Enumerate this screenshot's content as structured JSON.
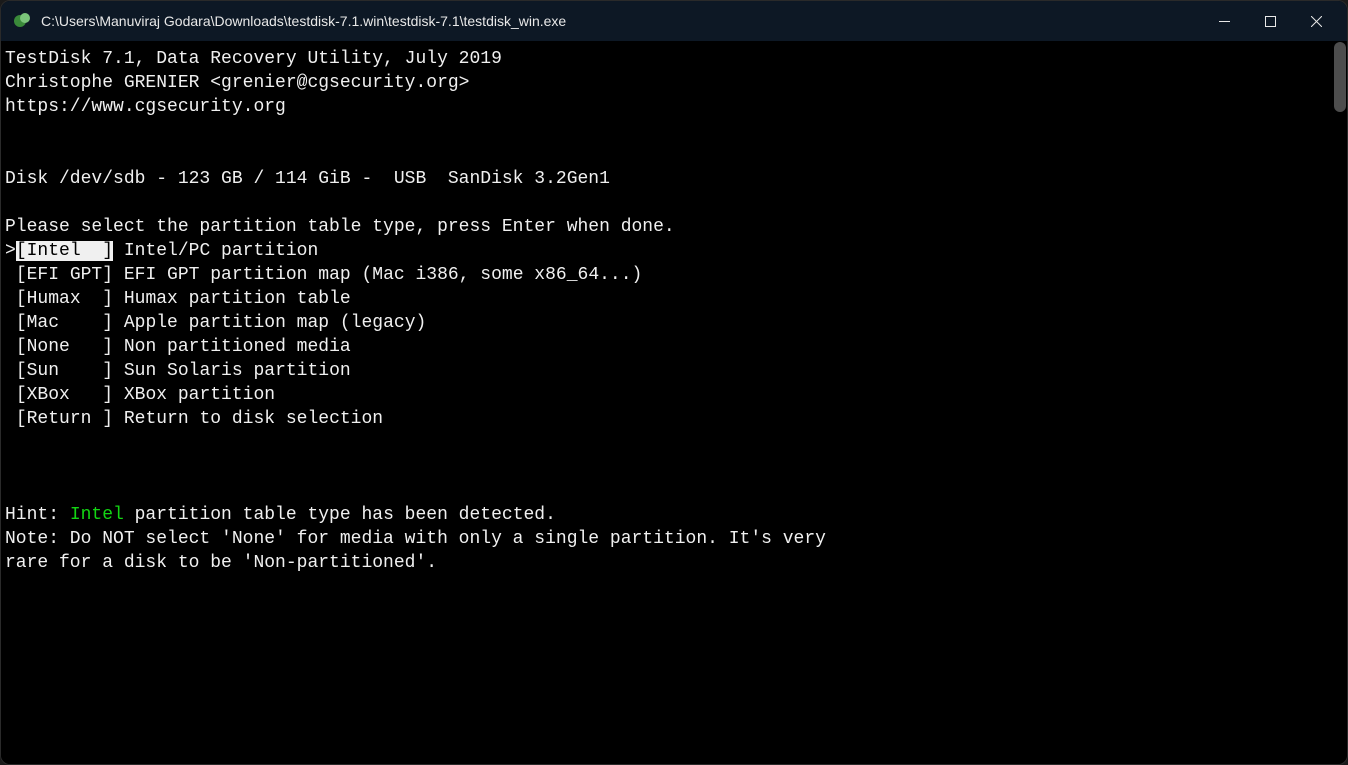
{
  "window": {
    "title": "C:\\Users\\Manuviraj Godara\\Downloads\\testdisk-7.1.win\\testdisk-7.1\\testdisk_win.exe"
  },
  "header": {
    "line1": "TestDisk 7.1, Data Recovery Utility, July 2019",
    "line2": "Christophe GRENIER <grenier@cgsecurity.org>",
    "line3": "https://www.cgsecurity.org"
  },
  "disk_line": "Disk /dev/sdb - 123 GB / 114 GiB -  USB  SanDisk 3.2Gen1",
  "prompt": "Please select the partition table type, press Enter when done.",
  "menu": {
    "selected_prefix": ">",
    "items": [
      {
        "label": "[Intel  ]",
        "desc": "Intel/PC partition",
        "selected": true
      },
      {
        "label": "[EFI GPT]",
        "desc": "EFI GPT partition map (Mac i386, some x86_64...)",
        "selected": false
      },
      {
        "label": "[Humax  ]",
        "desc": "Humax partition table",
        "selected": false
      },
      {
        "label": "[Mac    ]",
        "desc": "Apple partition map (legacy)",
        "selected": false
      },
      {
        "label": "[None   ]",
        "desc": "Non partitioned media",
        "selected": false
      },
      {
        "label": "[Sun    ]",
        "desc": "Sun Solaris partition",
        "selected": false
      },
      {
        "label": "[XBox   ]",
        "desc": "XBox partition",
        "selected": false
      },
      {
        "label": "[Return ]",
        "desc": "Return to disk selection",
        "selected": false
      }
    ]
  },
  "hint": {
    "prefix": "Hint: ",
    "detected": "Intel",
    "suffix": " partition table type has been detected."
  },
  "note": {
    "line1": "Note: Do NOT select 'None' for media with only a single partition. It's very",
    "line2": "rare for a disk to be 'Non-partitioned'."
  }
}
